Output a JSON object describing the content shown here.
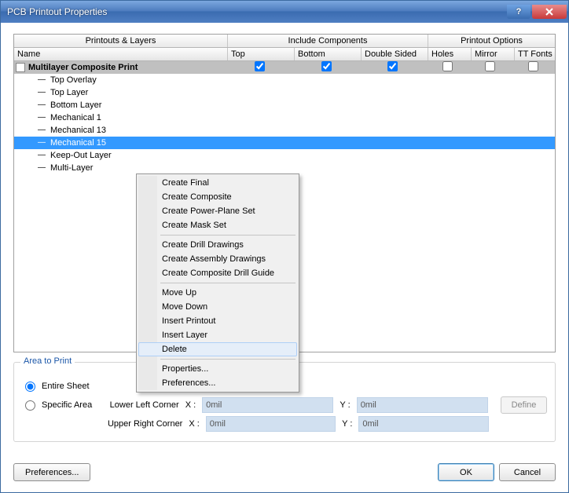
{
  "window": {
    "title": "PCB Printout Properties"
  },
  "grid": {
    "group_printouts": "Printouts & Layers",
    "group_include": "Include Components",
    "group_opts": "Printout Options",
    "col_name": "Name",
    "col_top": "Top",
    "col_bottom": "Bottom",
    "col_ds": "Double Sided",
    "col_holes": "Holes",
    "col_mirror": "Mirror",
    "col_tt": "TT Fonts"
  },
  "rows": {
    "parent": "Multilayer Composite Print",
    "children": [
      "Top Overlay",
      "Top Layer",
      "Bottom Layer",
      "Mechanical 1",
      "Mechanical 13",
      "Mechanical 15",
      "Keep-Out Layer",
      "Multi-Layer"
    ]
  },
  "context_menu": {
    "groups": [
      [
        "Create Final",
        "Create Composite",
        "Create Power-Plane Set",
        "Create Mask Set"
      ],
      [
        "Create Drill Drawings",
        "Create Assembly Drawings",
        "Create Composite Drill Guide"
      ],
      [
        "Move Up",
        "Move Down",
        "Insert Printout",
        "Insert Layer",
        "Delete"
      ],
      [
        "Properties...",
        "Preferences..."
      ]
    ],
    "highlighted": "Delete"
  },
  "area": {
    "title": "Area to Print",
    "entire": "Entire Sheet",
    "specific": "Specific Area",
    "llc": "Lower Left Corner",
    "urc": "Upper Right Corner",
    "x": "X :",
    "y": "Y :",
    "val": "0mil",
    "define": "Define"
  },
  "buttons": {
    "prefs": "Preferences...",
    "ok": "OK",
    "cancel": "Cancel"
  }
}
